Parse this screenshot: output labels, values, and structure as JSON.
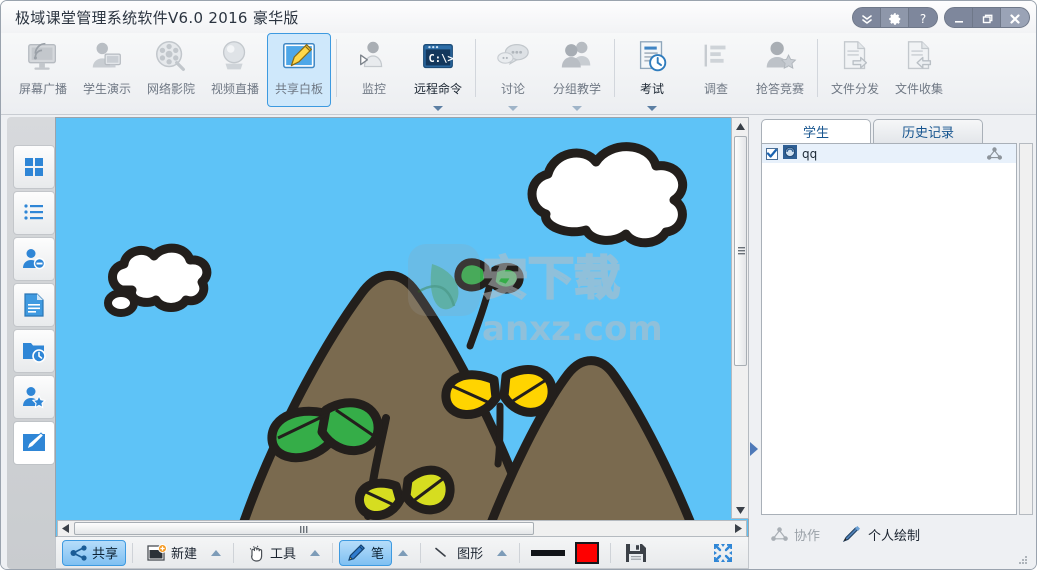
{
  "window": {
    "title": "极域课堂管理系统软件V6.0 2016 豪华版",
    "controls": {
      "expand": "chevrons-down",
      "settings": "gear",
      "help": "?",
      "minimize": "minimize",
      "restore": "restore",
      "close": "close"
    }
  },
  "ribbon": {
    "items": [
      {
        "label": "屏幕广播",
        "icon": "screen-broadcast-icon",
        "enabled": false,
        "selected": false,
        "dropdown": false
      },
      {
        "label": "学生演示",
        "icon": "student-demo-icon",
        "enabled": false,
        "selected": false,
        "dropdown": false
      },
      {
        "label": "网络影院",
        "icon": "net-movie-icon",
        "enabled": false,
        "selected": false,
        "dropdown": false
      },
      {
        "label": "视频直播",
        "icon": "video-live-icon",
        "enabled": false,
        "selected": false,
        "dropdown": false
      },
      {
        "label": "共享白板",
        "icon": "shared-whiteboard-icon",
        "enabled": true,
        "selected": true,
        "dropdown": false
      },
      {
        "label": "监控",
        "icon": "monitor-icon",
        "enabled": false,
        "selected": false,
        "dropdown": false
      },
      {
        "label": "远程命令",
        "icon": "remote-command-icon",
        "enabled": true,
        "selected": false,
        "dropdown": true
      },
      {
        "label": "讨论",
        "icon": "discussion-icon",
        "enabled": false,
        "selected": false,
        "dropdown": true
      },
      {
        "label": "分组教学",
        "icon": "group-teaching-icon",
        "enabled": false,
        "selected": false,
        "dropdown": true
      },
      {
        "label": "考试",
        "icon": "exam-icon",
        "enabled": true,
        "selected": false,
        "dropdown": true
      },
      {
        "label": "调查",
        "icon": "survey-icon",
        "enabled": false,
        "selected": false,
        "dropdown": false
      },
      {
        "label": "抢答竞赛",
        "icon": "quiz-race-icon",
        "enabled": false,
        "selected": false,
        "dropdown": false
      },
      {
        "label": "文件分发",
        "icon": "file-distribute-icon",
        "enabled": false,
        "selected": false,
        "dropdown": false
      },
      {
        "label": "文件收集",
        "icon": "file-collect-icon",
        "enabled": false,
        "selected": false,
        "dropdown": false
      }
    ]
  },
  "sidebar": {
    "items": [
      {
        "icon": "grid-view-icon",
        "active": false
      },
      {
        "icon": "list-view-icon",
        "active": false
      },
      {
        "icon": "user-remove-icon",
        "active": false
      },
      {
        "icon": "document-icon",
        "active": false
      },
      {
        "icon": "history-folder-icon",
        "active": false
      },
      {
        "icon": "user-star-icon",
        "active": false
      },
      {
        "icon": "whiteboard-pen-icon",
        "active": true
      }
    ]
  },
  "canvas": {
    "sky_color": "#5ec3f7",
    "mountain_color": "#7a6a4f",
    "outline_color": "#231f1c",
    "cloud_color": "#ffffff",
    "leaf_green": "#35ad48",
    "leaf_yellow": "#ffd400",
    "leaf_olive": "#d6dd20",
    "watermark_main": "安下载",
    "watermark_sub": "anxz.com"
  },
  "drawbar": {
    "share_label": "共享",
    "new_label": "新建",
    "tools_label": "工具",
    "pen_label": "笔",
    "shape_label": "图形",
    "line_width_swatch": "#111418",
    "color_swatch": "#fe0000",
    "save_icon": "save-floppy-icon",
    "fullscreen_icon": "fullscreen-expand-icon"
  },
  "right_panel": {
    "tabs": [
      {
        "label": "学生",
        "active": true
      },
      {
        "label": "历史记录",
        "active": false
      }
    ],
    "students": [
      {
        "name": "qq",
        "checked": true,
        "icon": "student-avatar-icon",
        "status_icon": "network-share-icon"
      }
    ],
    "status": {
      "collab_label": "协作",
      "collab_icon": "collab-network-icon",
      "personal_label": "个人绘制",
      "personal_icon": "brush-icon",
      "collab_enabled": false,
      "personal_enabled": true
    }
  }
}
